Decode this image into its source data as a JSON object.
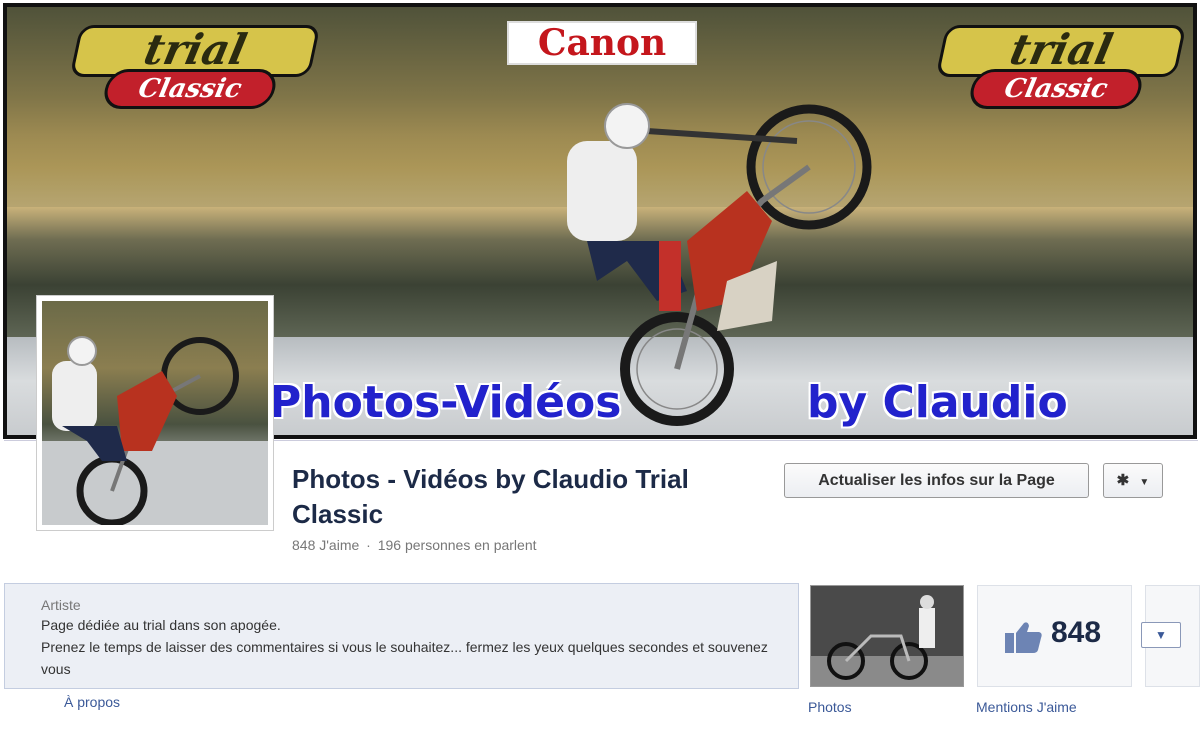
{
  "cover": {
    "logo_top_text": "trial",
    "logo_bottom_text": "Classic",
    "sponsor_text": "Canon",
    "overlay_left": "Photos-Vidéos",
    "overlay_right": "by Claudio"
  },
  "page": {
    "title": "Photos - Vidéos by Claudio Trial Classic",
    "likes_stat": "848 J'aime",
    "dot": "·",
    "talking_stat": "196 personnes en parlent"
  },
  "actions": {
    "update_button": "Actualiser les infos sur la Page",
    "gear_icon": "gear-icon",
    "dropdown_icon": "chevron-down-icon"
  },
  "about": {
    "category": "Artiste",
    "line1": "Page dédiée au trial dans son apogée.",
    "line2": "Prenez le temps de laisser des commentaires si vous le souhaitez... fermez les yeux quelques secondes et souvenez vous",
    "link": "À propos"
  },
  "tiles": {
    "photos_label": "Photos",
    "likes_count": "848",
    "likes_label": "Mentions J'aime",
    "thumb_icon": "thumbs-up-icon"
  },
  "colors": {
    "brand_blue": "#3b5998",
    "title_navy": "#1c2a47",
    "cover_text": "#2222cc"
  }
}
